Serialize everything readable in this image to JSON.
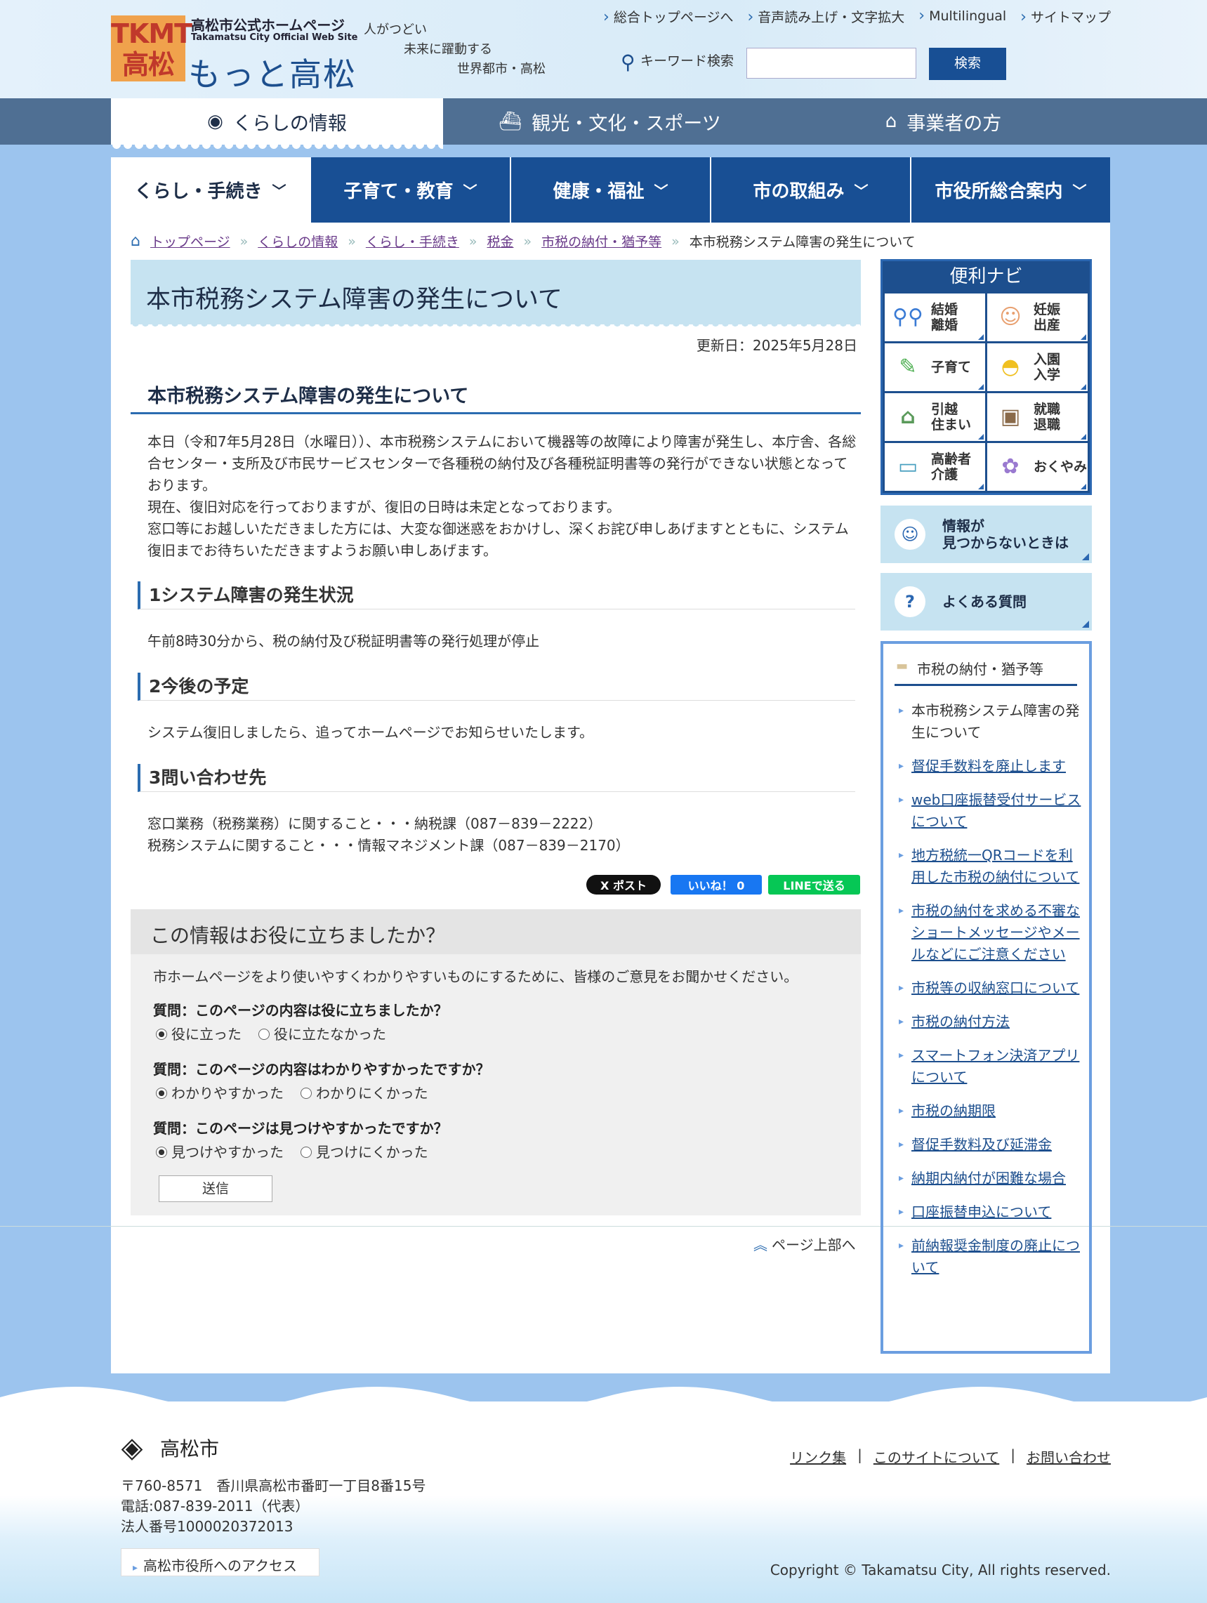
{
  "header": {
    "logo_mark": [
      "TKMT",
      "高松"
    ],
    "site_label": "高松市公式ホームページ",
    "site_label_en": "Takamatsu City Official Web Site",
    "site_name": "もっと高松",
    "catch_lines": [
      "人がつどい",
      "未来に躍動する",
      "世界都市・高松"
    ],
    "top_links": [
      "総合トップページへ",
      "音声読み上げ・文字拡大",
      "Multilingual",
      "サイトマップ"
    ],
    "search_label": "キーワード検索",
    "search_value": "",
    "search_button": "検索"
  },
  "band_tabs": [
    {
      "label": "くらしの情報",
      "icon": "bowl-icon"
    },
    {
      "label": "観光・文化・スポーツ",
      "icon": "ship-icon"
    },
    {
      "label": "事業者の方",
      "icon": "building-icon"
    }
  ],
  "nav": [
    "くらし・手続き",
    "子育て・教育",
    "健康・福祉",
    "市の取組み",
    "市役所総合案内"
  ],
  "breadcrumb": [
    "トップページ",
    "くらしの情報",
    "くらし・手続き",
    "税金",
    "市税の納付・猶予等",
    "本市税務システム障害の発生について"
  ],
  "page": {
    "title": "本市税務システム障害の発生について",
    "updated": "更新日：2025年5月28日",
    "heading": "本市税務システム障害の発生について",
    "body": [
      "本日（令和7年5月28日（水曜日））、本市税務システムにおいて機器等の故障により障害が発生し、本庁舎、各総合センター・支所及び市民サービスセンターで各種税の納付及び各種税証明書等の発行ができない状態となっております。",
      "現在、復旧対応を行っておりますが、復旧の日時は未定となっております。",
      "窓口等にお越しいただきました方には、大変な御迷惑をおかけし、深くお詫び申しあげますとともに、システム復旧までお待ちいただきますようお願い申しあげます。"
    ],
    "sections": [
      {
        "title": "1システム障害の発生状況",
        "text": [
          "午前8時30分から、税の納付及び税証明書等の発行処理が停止"
        ]
      },
      {
        "title": "2今後の予定",
        "text": [
          "システム復旧しましたら、追ってホームページでお知らせいたします。"
        ]
      },
      {
        "title": "3問い合わせ先",
        "text": [
          "窓口業務（税務業務）に関すること・・・納税課（087－839－2222）",
          "税務システムに関すること・・・情報マネジメント課（087－839－2170）"
        ]
      }
    ]
  },
  "sns": {
    "x": "X ポスト",
    "fb": "いいね！ 0",
    "line": "LINEで送る"
  },
  "survey": {
    "title": "この情報はお役に立ちましたか？",
    "intro": "市ホームページをより使いやすくわかりやすいものにするために、皆様のご意見をお聞かせください。",
    "questions": [
      {
        "q": "質問：このページの内容は役に立ちましたか？",
        "options": [
          "役に立った",
          "役に立たなかった"
        ],
        "selected": 0
      },
      {
        "q": "質問：このページの内容はわかりやすかったですか？",
        "options": [
          "わかりやすかった",
          "わかりにくかった"
        ],
        "selected": 0
      },
      {
        "q": "質問：このページは見つけやすかったですか？",
        "options": [
          "見つけやすかった",
          "見つけにくかった"
        ],
        "selected": 0
      }
    ],
    "submit": "送信"
  },
  "page_top": "ページ上部へ",
  "side": {
    "navi_title": "便利ナビ",
    "navi": [
      {
        "label": "結婚\n離婚",
        "icon": "couple-icon"
      },
      {
        "label": "妊娠\n出産",
        "icon": "baby-icon"
      },
      {
        "label": "子育て",
        "icon": "pencil-icon"
      },
      {
        "label": "入園\n入学",
        "icon": "hat-icon"
      },
      {
        "label": "引越\n住まい",
        "icon": "house-icon"
      },
      {
        "label": "就職\n退職",
        "icon": "briefcase-icon"
      },
      {
        "label": "高齢者\n介護",
        "icon": "bed-icon"
      },
      {
        "label": "おくやみ",
        "icon": "flower-icon"
      }
    ],
    "notfound": "情報が\n見つからないときは",
    "faq": "よくある質問",
    "related_title": "市税の納付・猶予等",
    "related": [
      "本市税務システム障害の発生について",
      "督促手数料を廃止します",
      "web口座振替受付サービスについて",
      "地方税統一QRコードを利用した市税の納付について",
      "市税の納付を求める不審なショートメッセージやメールなどにご注意ください",
      "市税等の収納窓口について",
      "市税の納付方法",
      "スマートフォン決済アプリについて",
      "市税の納期限",
      "督促手数料及び延滞金",
      "納期内納付が困難な場合",
      "口座振替申込について",
      "前納報奨金制度の廃止について"
    ]
  },
  "footer": {
    "city": "高松市",
    "address": [
      "〒760-8571　香川県高松市番町一丁目8番15号",
      "電話:087-839-2011（代表）",
      "法人番号1000020372013"
    ],
    "links": [
      "リンク集",
      "このサイトについて",
      "お問い合わせ"
    ],
    "access": "高松市役所へのアクセス",
    "copyright": "Copyright © Takamatsu City, All rights reserved."
  },
  "colors": {
    "navy": "#184f94",
    "band": "#4f6f93",
    "light_blue": "#c6e3f1",
    "link": "#1d4f8e"
  }
}
